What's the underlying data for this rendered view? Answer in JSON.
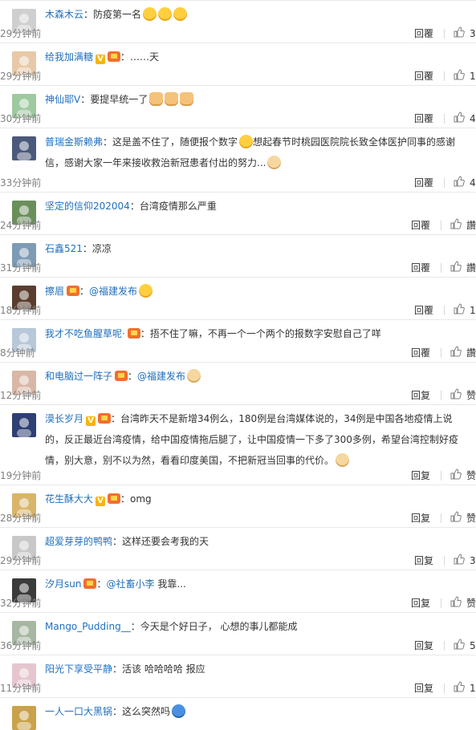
{
  "comments": [
    {
      "user": "木森木云",
      "user_color": "blue",
      "badges": [],
      "content": "：防疫第一名",
      "emojis": [
        "smile",
        "smile",
        "smile"
      ],
      "time": "29分钟前",
      "reply": "回覆",
      "likes": "3",
      "h": 53
    },
    {
      "user": "给我加满糖",
      "user_color": "blue",
      "badges": [
        "v",
        "vip"
      ],
      "content": "：……天",
      "emojis": [],
      "time": "29分钟前",
      "reply": "回覆",
      "likes": "1",
      "h": 53
    },
    {
      "user": "神仙耶V",
      "user_color": "blue",
      "badges": [],
      "content": "：要提早统一了",
      "emojis": [
        "thumb",
        "thumb",
        "thumb"
      ],
      "time": "30分钟前",
      "reply": "回覆",
      "likes": "4",
      "h": 53
    },
    {
      "user": "普瑞金斯赖弗",
      "user_color": "blue",
      "badges": [],
      "content": "：这是盖不住了，随便报个数字",
      "content2": "想起春节时桃园医院院长致全体医护同事的感谢信，感谢大家一年来接收救治新冠患者付出的努力...",
      "emojis": [],
      "mid_emoji": "laugh",
      "end_emoji": "cat",
      "time": "33分钟前",
      "reply": "回覆",
      "likes": "4",
      "h": 80
    },
    {
      "user": "坚定的信仰202004",
      "user_color": "blue",
      "badges": [],
      "content": "：台湾疫情那么严重",
      "emojis": [],
      "time": "24分钟前",
      "reply": "回覆",
      "likes": "讚",
      "h": 53
    },
    {
      "user": "石鑫521",
      "user_color": "blue",
      "badges": [],
      "content": "：凉凉",
      "emojis": [],
      "time": "31分钟前",
      "reply": "回覆",
      "likes": "讚",
      "h": 53
    },
    {
      "user": "擦眉",
      "user_color": "blue",
      "badges": [
        "vip"
      ],
      "content": "：",
      "mention": "@福建发布",
      "emojis": [
        "smile"
      ],
      "time": "18分钟前",
      "reply": "回覆",
      "likes": "1",
      "h": 53
    },
    {
      "user": "我才不吃鱼腥草呢·",
      "user_color": "blue",
      "badges": [
        "vip"
      ],
      "content": "：捂不住了嘛，不再一个一个两个的报数字安慰自己了咩",
      "emojis": [],
      "time": "8分钟前",
      "reply": "回覆",
      "likes": "讚",
      "h": 53
    },
    {
      "user": "和电脑过一阵子",
      "user_color": "blue",
      "badges": [
        "vip"
      ],
      "content": "：",
      "mention": "@福建发布",
      "emojis": [
        "cat"
      ],
      "time": "12分钟前",
      "reply": "回复",
      "likes": "赞",
      "h": 53
    },
    {
      "user": "漠长岁月",
      "user_color": "blue",
      "badges": [
        "v",
        "vip"
      ],
      "content": "：台湾昨天不是新增34例么，180例是台湾媒体说的，34例是中国各地疫情上说的，反正最近台湾疫情，给中国疫情拖后腿了，让中国疫情一下多了300多例，希望台湾控制好疫情，别大意，别不以为然，看看印度美国，不把新冠当回事的代价。",
      "emojis": [
        "cat"
      ],
      "time": "19分钟前",
      "reply": "回复",
      "likes": "赞",
      "h": 100
    },
    {
      "user": "花生酥大大",
      "user_color": "blue",
      "badges": [
        "v",
        "vip"
      ],
      "content": "：omg",
      "emojis": [],
      "time": "28分钟前",
      "reply": "回复",
      "likes": "赞",
      "h": 53
    },
    {
      "user": "超爱芽芽的鸭鸭",
      "user_color": "blue",
      "badges": [],
      "content": "：这样还要会考我的天",
      "emojis": [],
      "time": "29分钟前",
      "reply": "回复",
      "likes": "3",
      "h": 53
    },
    {
      "user": "汐月sun",
      "user_color": "blue",
      "badges": [
        "vip"
      ],
      "content": "：",
      "mention": "@社畜小李",
      "content_after": " 我靠...",
      "emojis": [],
      "time": "32分钟前",
      "reply": "回复",
      "likes": "赞",
      "h": 53
    },
    {
      "user": "Mango_Pudding__",
      "user_color": "blue",
      "badges": [],
      "content": "：今天是个好日子，  心想的事儿都能成",
      "emojis": [],
      "time": "36分钟前",
      "reply": "回复",
      "likes": "5",
      "h": 53
    },
    {
      "user": "阳光下享受平静",
      "user_color": "blue",
      "badges": [],
      "content": "：活该 哈哈哈哈 报应",
      "emojis": [],
      "time": "11分钟前",
      "reply": "回复",
      "likes": "1",
      "h": 53
    },
    {
      "user": "一人一口大黑锅",
      "user_color": "blue",
      "badges": [],
      "content": "：这么突然吗",
      "emojis": [
        "blue"
      ],
      "time": "",
      "reply": "",
      "likes": "",
      "h": 34
    }
  ],
  "icons": {
    "like": "thumbs-up-icon",
    "avatar": "avatar-image"
  }
}
